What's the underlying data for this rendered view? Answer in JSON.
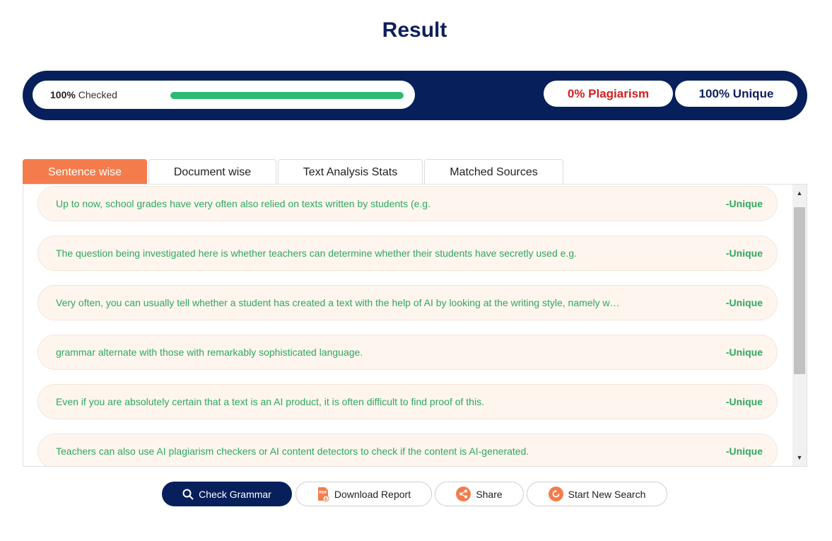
{
  "page": {
    "title": "Result"
  },
  "progress": {
    "percent_label": "100%",
    "checked_label": "Checked",
    "fraction": 1.0
  },
  "results": {
    "plagiarism": "0% Plagiarism",
    "unique": "100% Unique"
  },
  "tabs": [
    {
      "label": "Sentence wise",
      "active": true
    },
    {
      "label": "Document wise",
      "active": false
    },
    {
      "label": "Text Analysis Stats",
      "active": false
    },
    {
      "label": "Matched Sources",
      "active": false
    }
  ],
  "sentences": [
    {
      "text": "Up to now, school grades have very often also relied on texts written by students (e.g.",
      "status": "-Unique"
    },
    {
      "text": "The question being investigated here is whether teachers can determine whether their students have secretly used e.g.",
      "status": "-Unique"
    },
    {
      "text": "Very often, you can usually tell whether a student has created a text with the help of AI by looking at the writing style, namely w…",
      "status": "-Unique"
    },
    {
      "text": "grammar alternate with those with remarkably sophisticated language.",
      "status": "-Unique"
    },
    {
      "text": "Even if you are absolutely certain that a text is an AI product, it is often difficult to find proof of this.",
      "status": "-Unique"
    },
    {
      "text": "Teachers can also use AI plagiarism checkers or AI content detectors to check if the content is AI-generated.",
      "status": "-Unique"
    }
  ],
  "actions": {
    "check_grammar": "Check Grammar",
    "download_report": "Download Report",
    "share": "Share",
    "start_new_search": "Start New Search"
  },
  "icons": {
    "check_grammar": "search-icon",
    "download_report": "pdf-download-icon",
    "share": "share-icon",
    "start_new_search": "refresh-icon"
  },
  "colors": {
    "navy": "#07205b",
    "accent_orange": "#f47c4c",
    "progress_green": "#2dba72",
    "unique_green": "#2ea85f",
    "plagiarism_red": "#d02020"
  }
}
